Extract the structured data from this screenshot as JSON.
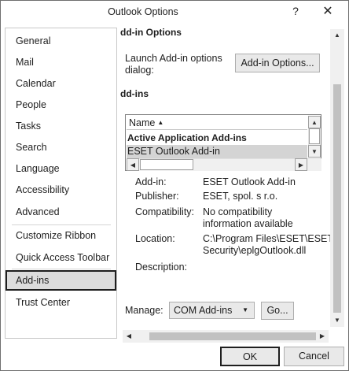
{
  "window": {
    "title": "Outlook Options"
  },
  "titlebar": {
    "help_glyph": "?",
    "close_glyph": "✕"
  },
  "sidebar": {
    "items": [
      {
        "label": "General"
      },
      {
        "label": "Mail"
      },
      {
        "label": "Calendar"
      },
      {
        "label": "People"
      },
      {
        "label": "Tasks"
      },
      {
        "label": "Search"
      },
      {
        "label": "Language"
      },
      {
        "label": "Accessibility"
      },
      {
        "label": "Advanced"
      },
      {
        "label": "Customize Ribbon"
      },
      {
        "label": "Quick Access Toolbar"
      },
      {
        "label": "Add-ins",
        "selected": true
      },
      {
        "label": "Trust Center"
      }
    ]
  },
  "addin_options": {
    "heading": "dd-in Options",
    "launch_text_1": "Launch Add-in options",
    "launch_text_2": "dialog:",
    "button_label": "Add-in Options..."
  },
  "addins": {
    "heading": "dd-ins",
    "list": {
      "header": "Name",
      "sort_glyph": "▲",
      "group": "Active Application Add-ins",
      "selected_row": "ESET Outlook Add-in"
    },
    "details": {
      "addin_label": "Add-in:",
      "addin_value": "ESET Outlook Add-in",
      "publisher_label": "Publisher:",
      "publisher_value": "ESET, spol. s r.o.",
      "compat_label": "Compatibility:",
      "compat_value_1": "No compatibility",
      "compat_value_2": "information available",
      "location_label": "Location:",
      "location_value_1": "C:\\Program Files\\ESET\\ESET",
      "location_value_2": "Security\\eplgOutlook.dll",
      "description_label": "Description:"
    },
    "manage": {
      "label": "Manage:",
      "selected": "COM Add-ins",
      "go_label": "Go..."
    }
  },
  "scroll_glyphs": {
    "up": "▲",
    "down": "▼",
    "left": "◀",
    "right": "▶"
  },
  "footer": {
    "ok_label": "OK",
    "cancel_label": "Cancel"
  },
  "colors": {
    "selected_bg": "#dcdcdc",
    "button_bg": "#e9e9e9",
    "focus_border": "#1e1e1e"
  }
}
